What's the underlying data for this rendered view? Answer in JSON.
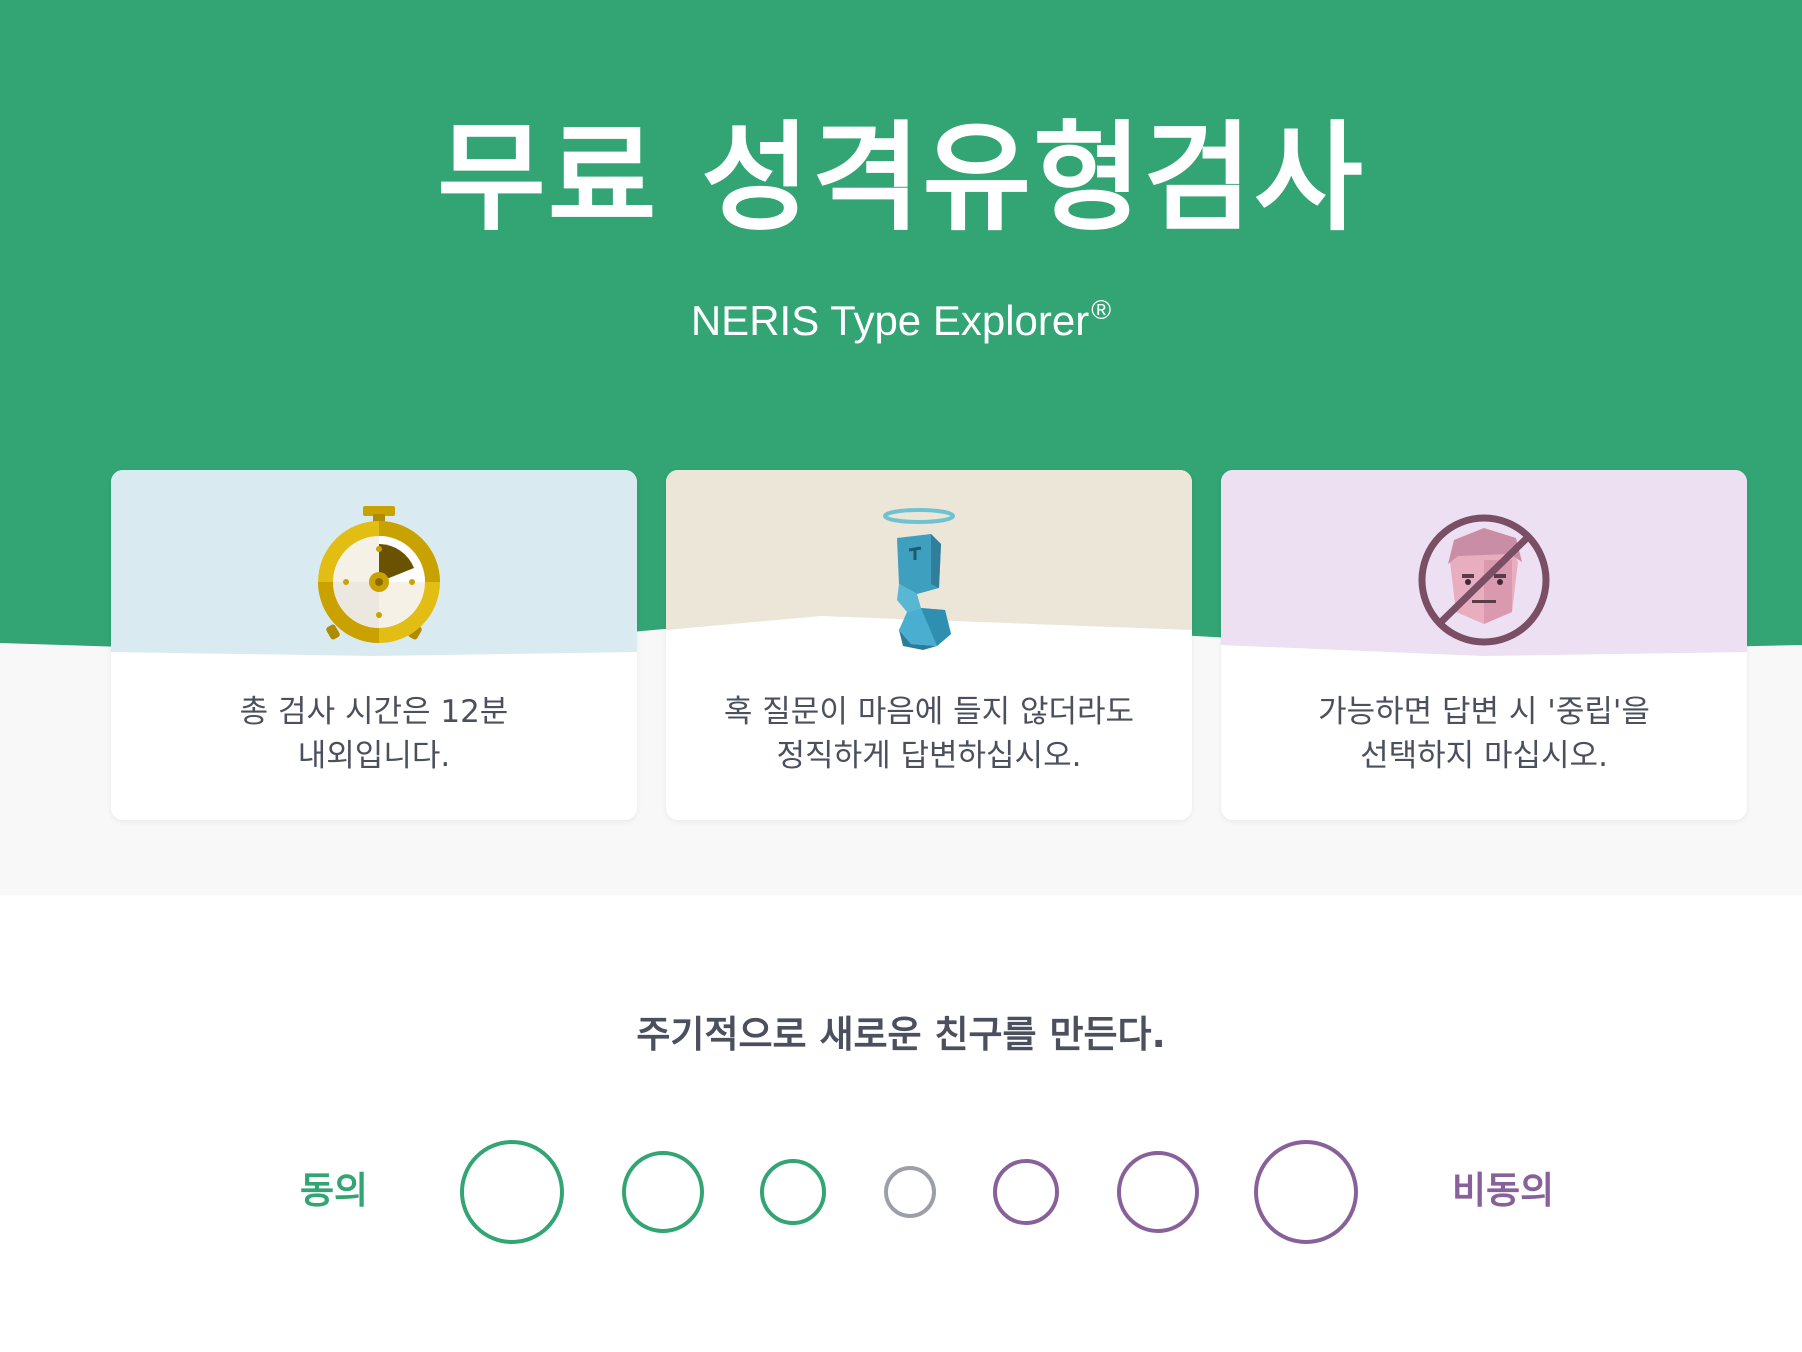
{
  "hero": {
    "title": "무료 성격유형검사",
    "subtitle": "NERIS Type Explorer",
    "subtitle_mark": "®",
    "colors": {
      "green": "#33a474",
      "light_gray": "#f8f8f8"
    }
  },
  "cards": [
    {
      "icon": "stopwatch-icon",
      "line1": "총 검사 시간은 12분",
      "line2": "내외입니다.",
      "color": "#d9ebf1"
    },
    {
      "icon": "angel-figure-icon",
      "line1": "혹 질문이 마음에 들지 않더라도",
      "line2": "정직하게 답변하십시오.",
      "color": "#ebe6d8"
    },
    {
      "icon": "no-neutral-face-icon",
      "line1": "가능하면 답변 시 '중립'을",
      "line2": "선택하지 마십시오.",
      "color": "#ece0f2"
    }
  ],
  "question": {
    "text": "주기적으로 새로운 친구를 만든다.",
    "agree_label": "동의",
    "disagree_label": "비동의",
    "option_count": 7,
    "colors": {
      "agree": "#33a474",
      "neutral": "#9b9faa",
      "disagree": "#88619a"
    }
  }
}
